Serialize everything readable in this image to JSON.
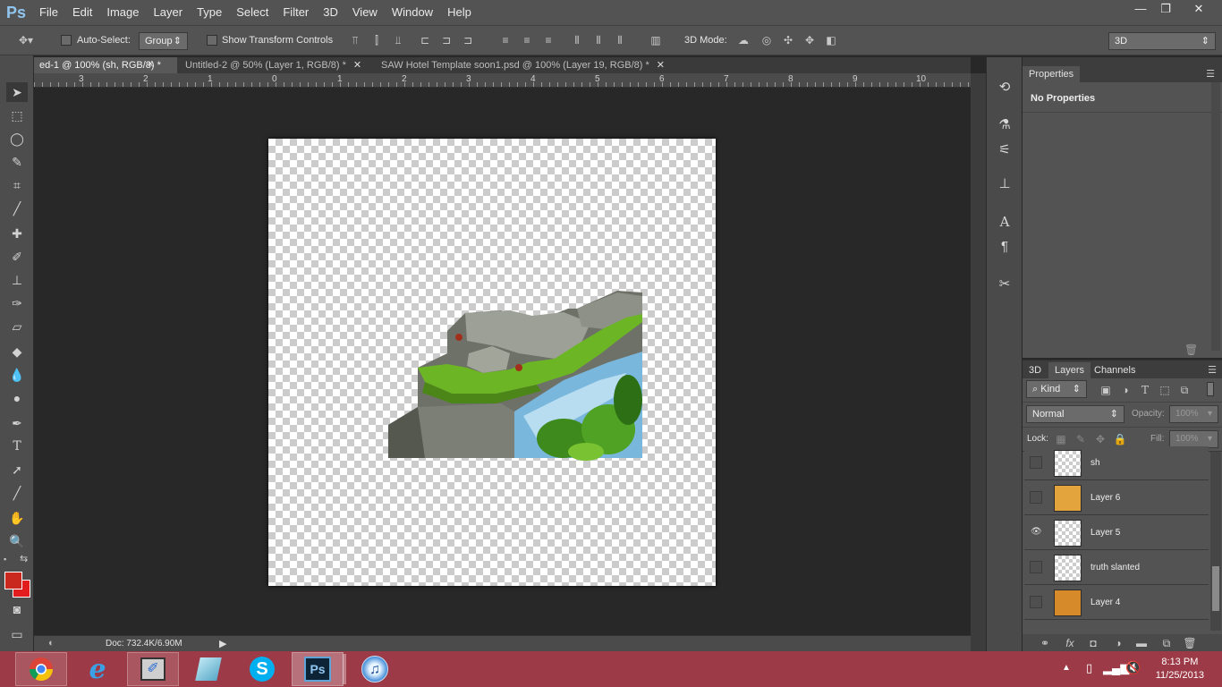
{
  "app": {
    "logo": "Ps"
  },
  "menubar": {
    "items": [
      "File",
      "Edit",
      "Image",
      "Layer",
      "Type",
      "Select",
      "Filter",
      "3D",
      "View",
      "Window",
      "Help"
    ]
  },
  "window_controls": {
    "minimize": "—",
    "restore": "❐",
    "close": "✕"
  },
  "options": {
    "auto_select_label": "Auto-Select:",
    "auto_select_value": "Group",
    "show_transform_label": "Show Transform Controls",
    "mode_label": "3D Mode:",
    "workspace_value": "3D"
  },
  "tabs": [
    {
      "label": "ed-1 @ 100% (sh, RGB/8) *",
      "active": true
    },
    {
      "label": "Untitled-2 @ 50% (Layer 1, RGB/8) *",
      "active": false
    },
    {
      "label": "SAW Hotel Template soon1.psd @ 100% (Layer 19, RGB/8) *",
      "active": false
    }
  ],
  "ruler": {
    "labels": [
      "3",
      "2",
      "1",
      "0",
      "1",
      "2",
      "3",
      "4",
      "5",
      "6",
      "7",
      "8",
      "9",
      "10"
    ]
  },
  "status": {
    "doc": "Doc: 732.4K/6.90M"
  },
  "properties": {
    "tab": "Properties",
    "content": "No Properties"
  },
  "layers_panel": {
    "tabs": [
      "3D",
      "Layers",
      "Channels"
    ],
    "filter_kind": "Kind",
    "blend_mode": "Normal",
    "opacity_label": "Opacity:",
    "opacity_value": "100%",
    "lock_label": "Lock:",
    "fill_label": "Fill:",
    "fill_value": "100%",
    "layers": [
      {
        "name": "sh",
        "visible": false
      },
      {
        "name": "Layer 6",
        "visible": false
      },
      {
        "name": "Layer 5",
        "visible": true
      },
      {
        "name": "truth slanted",
        "visible": false
      },
      {
        "name": "Layer 4",
        "visible": false
      }
    ]
  },
  "taskbar": {
    "apps": [
      "chrome-icon",
      "ie-icon",
      "paint-icon",
      "notes-icon",
      "skype-icon",
      "photoshop-icon",
      "itunes-icon"
    ],
    "time": "8:13 PM",
    "date": "11/25/2013"
  },
  "colors": {
    "foreground": "#c8281e",
    "background": "#e11d1d",
    "taskbar": "#9c3b47"
  }
}
